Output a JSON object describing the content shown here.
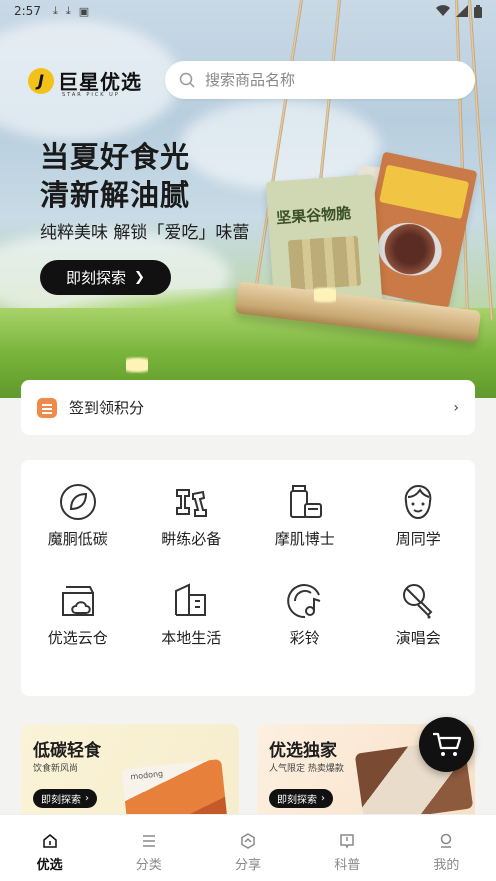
{
  "status_bar": {
    "time": "2:57",
    "left_icons": [
      "download-icon",
      "download-icon",
      "photo-icon"
    ],
    "right_icons": [
      "wifi-icon",
      "signal-icon",
      "battery-icon"
    ]
  },
  "header": {
    "logo_text": "巨星优选",
    "logo_subtext": "STAR PICK UP",
    "search": {
      "placeholder": "搜索商品名称",
      "icon": "search-icon"
    }
  },
  "banner": {
    "headline_line1": "当夏好食光",
    "headline_line2": "清新解油腻",
    "subline": "纯粹美味  解锁「爱吃」味蕾",
    "cta_label": "即刻探索",
    "product_label": "坚果谷物脆"
  },
  "checkin": {
    "label": "签到领积分",
    "icon": "document-icon"
  },
  "categories": [
    {
      "label": "魔胴低碳",
      "icon": "leaf-icon"
    },
    {
      "label": "畊练必备",
      "icon": "dumbbell-icon"
    },
    {
      "label": "摩肌博士",
      "icon": "skincare-icon"
    },
    {
      "label": "周同学",
      "icon": "face-icon"
    },
    {
      "label": "优选云仓",
      "icon": "cloud-box-icon"
    },
    {
      "label": "本地生活",
      "icon": "building-icon"
    },
    {
      "label": "彩铃",
      "icon": "music-note-icon"
    },
    {
      "label": "演唱会",
      "icon": "microphone-icon"
    }
  ],
  "promos": [
    {
      "title": "低碳轻食",
      "desc": "饮食新风尚",
      "btn": "即刻探索",
      "brand": "modong"
    },
    {
      "title": "优选独家",
      "desc": "人气限定 热卖爆款",
      "btn": "即刻探索"
    }
  ],
  "bottom_nav": [
    {
      "label": "优选",
      "icon": "home-icon",
      "active": true
    },
    {
      "label": "分类",
      "icon": "list-icon",
      "active": false
    },
    {
      "label": "分享",
      "icon": "share-icon",
      "active": false
    },
    {
      "label": "科普",
      "icon": "book-icon",
      "active": false
    },
    {
      "label": "我的",
      "icon": "user-icon",
      "active": false
    }
  ],
  "colors": {
    "accent": "#111111",
    "checkin_icon": "#f08a4b",
    "logo_yellow": "#f2c21b"
  }
}
